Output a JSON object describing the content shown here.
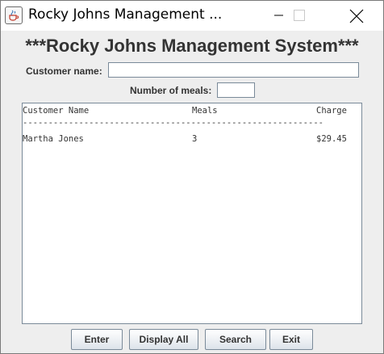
{
  "window": {
    "title": "Rocky Johns Management ...",
    "icon": "java-cup-icon"
  },
  "heading": "***Rocky Johns Management System***",
  "form": {
    "customer_label": "Customer name:",
    "customer_value": "",
    "meals_label": "Number of meals:",
    "meals_value": ""
  },
  "output": {
    "headers": [
      "Customer Name",
      "Meals",
      "Charge"
    ],
    "separator": "-----------------------------------------------------------",
    "rows": [
      [
        "Martha Jones",
        "3",
        "$29.45"
      ]
    ]
  },
  "buttons": {
    "enter": "Enter",
    "display_all": "Display All",
    "search": "Search",
    "exit": "Exit"
  }
}
